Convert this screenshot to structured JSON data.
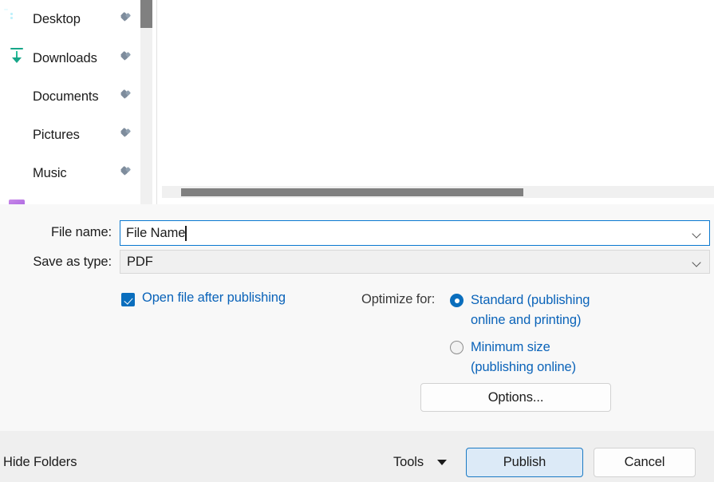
{
  "nav_pane": {
    "items": [
      {
        "label": "Desktop",
        "icon": "desktop-icon",
        "pinned": true
      },
      {
        "label": "Downloads",
        "icon": "download-icon",
        "pinned": true
      },
      {
        "label": "Documents",
        "icon": "documents-icon",
        "pinned": true
      },
      {
        "label": "Pictures",
        "icon": "pictures-icon",
        "pinned": true
      },
      {
        "label": "Music",
        "icon": "music-icon",
        "pinned": true
      }
    ],
    "pin_icon_name": "pin-icon"
  },
  "fields": {
    "file_name_label": "File name:",
    "file_name_value": "File Name",
    "save_as_type_label": "Save as type:",
    "save_as_type_value": "PDF",
    "dropdown_icon": "chevron-down-icon"
  },
  "options": {
    "open_file_checkbox_label": "Open file after publishing",
    "open_file_checked": true,
    "optimize_for_label": "Optimize for:",
    "radios": [
      {
        "label": "Standard (publishing\nonline and printing)",
        "selected": true
      },
      {
        "label": "Minimum size\n(publishing online)",
        "selected": false
      }
    ],
    "options_button_label": "Options..."
  },
  "footer": {
    "hide_folders_label": "Hide Folders",
    "tools_label": "Tools",
    "tools_dropdown_icon": "triangle-down-icon",
    "publish_label": "Publish",
    "cancel_label": "Cancel"
  },
  "colors": {
    "accent_blue": "#0a6ebd",
    "link_blue": "#0a63b9",
    "default_button_fill": "#dceaf7",
    "default_button_border": "#1b7ac4",
    "scrollbar_thumb": "#808080",
    "dialog_background": "#f8f8f8",
    "footer_background": "#efefef"
  }
}
